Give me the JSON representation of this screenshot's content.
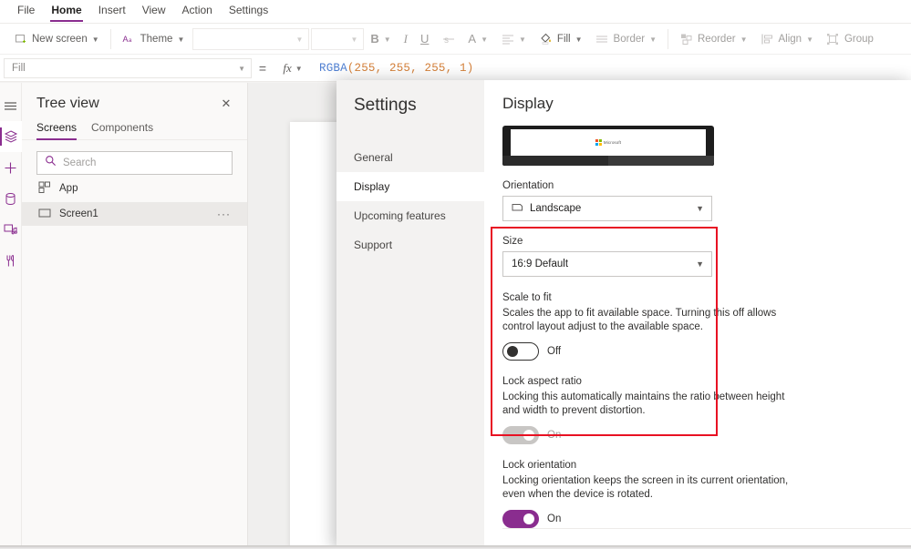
{
  "menubar": {
    "items": [
      {
        "label": "File",
        "active": false
      },
      {
        "label": "Home",
        "active": true
      },
      {
        "label": "Insert",
        "active": false
      },
      {
        "label": "View",
        "active": false
      },
      {
        "label": "Action",
        "active": false
      },
      {
        "label": "Settings",
        "active": false
      }
    ]
  },
  "ribbon": {
    "new_screen": "New screen",
    "theme": "Theme",
    "font_family_value": "",
    "font_size_value": "",
    "bold": "B",
    "italic": "I",
    "underline": "U",
    "strikethrough": "S",
    "font_color": "A",
    "align": "",
    "fill": "Fill",
    "border": "Border",
    "reorder": "Reorder",
    "align_objects": "Align",
    "group": "Group"
  },
  "formula_bar": {
    "property": "Fill",
    "equals": "=",
    "fx": "fx",
    "formula_function": "RGBA",
    "formula_open": "(",
    "formula_args": "255, 255, 255, 1",
    "formula_close": ")",
    "formula_full": "RGBA(255, 255, 255, 1)"
  },
  "left_rail": {
    "items": [
      {
        "name": "hamburger-menu",
        "label": "Menu"
      },
      {
        "name": "tree-view",
        "label": "Tree view",
        "selected": true
      },
      {
        "name": "insert",
        "label": "Insert"
      },
      {
        "name": "data",
        "label": "Data"
      },
      {
        "name": "media",
        "label": "Media"
      },
      {
        "name": "advanced-tools",
        "label": "Advanced tools"
      }
    ]
  },
  "tree_view": {
    "title": "Tree view",
    "close": "✕",
    "tabs": [
      {
        "label": "Screens",
        "active": true
      },
      {
        "label": "Components",
        "active": false
      }
    ],
    "search_placeholder": "Search",
    "rows": [
      {
        "label": "App",
        "icon": "app-icon",
        "selected": false,
        "has_menu": false
      },
      {
        "label": "Screen1",
        "icon": "screen-icon",
        "selected": true,
        "has_menu": true,
        "menu": "···"
      }
    ]
  },
  "settings_dialog": {
    "title": "Settings",
    "nav": [
      {
        "label": "General",
        "active": false
      },
      {
        "label": "Display",
        "active": true
      },
      {
        "label": "Upcoming features",
        "active": false
      },
      {
        "label": "Support",
        "active": false
      }
    ],
    "panel": {
      "heading": "Display",
      "device_logo_text": "Microsoft",
      "orientation": {
        "label": "Orientation",
        "value": "Landscape"
      },
      "size": {
        "label": "Size",
        "value": "16:9 Default"
      },
      "scale_to_fit": {
        "title": "Scale to fit",
        "description": "Scales the app to fit available space. Turning this off allows control layout adjust to the available space.",
        "toggle_state": "Off"
      },
      "lock_aspect_ratio": {
        "title": "Lock aspect ratio",
        "description": "Locking this automatically maintains the ratio between height and width to prevent distortion.",
        "toggle_state": "On"
      },
      "lock_orientation": {
        "title": "Lock orientation",
        "description": "Locking orientation keeps the screen in its current orientation, even when the device is rotated.",
        "toggle_state": "On"
      }
    }
  },
  "annotation": {
    "color": "#e81123",
    "shape": "rectangle"
  },
  "colors": {
    "accent": "#8a2d8f",
    "annotation_red": "#e81123",
    "panel_bg": "#f3f2f1",
    "canvas_bg": "#f0efee"
  }
}
